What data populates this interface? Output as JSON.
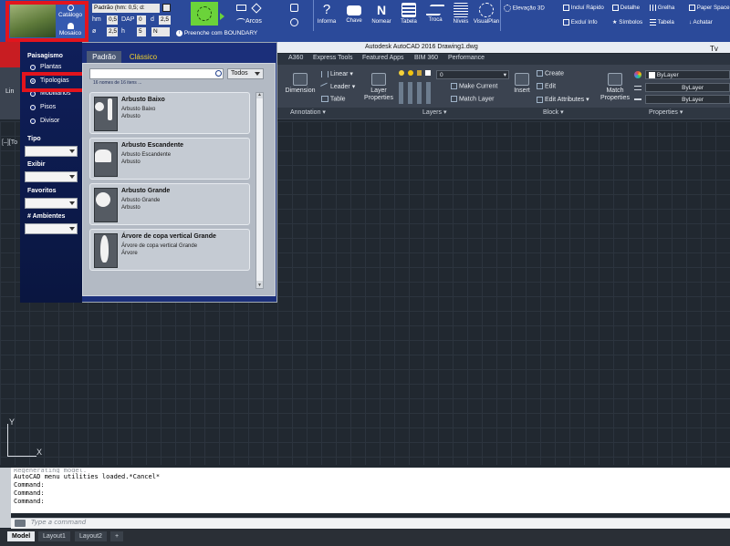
{
  "plugin_ribbon": {
    "catalogo_label": "Catálogo",
    "mosaico_label": "Mosaico",
    "pattern_select": "Padrão (hm: 0,5; d:",
    "hm_label": "hm",
    "hm_value": "0,5",
    "dap_label": "DAP",
    "dap_value": "0",
    "d_label": "d",
    "d_value": "2,5",
    "o_label": "ø",
    "o_value": "2,5",
    "h_label": "h",
    "h_value": "5",
    "n_value": "N",
    "preenche_label": "Preenche com BOUNDARY",
    "arcos_label": "Arcos",
    "buttons": [
      "Informa",
      "Chave",
      "Nomear",
      "Tabela",
      "Troca",
      "Níveis",
      "VisualPlan"
    ],
    "right_items": [
      "Elevação 3D",
      "Incluí Rápido",
      "Detalhe",
      "Grelha",
      "Paper Space",
      "Excluí Info",
      "Símbolos",
      "Tabela",
      "Achatar"
    ]
  },
  "window": {
    "title": "Autodesk AutoCAD 2016    Drawing1.dwg"
  },
  "ribbon_tabs": [
    "A360",
    "Express Tools",
    "Featured Apps",
    "BIM 360",
    "Performance"
  ],
  "autocad_ribbon": {
    "linear_label": "Linear",
    "leader_label": "Leader",
    "table_label": "Table",
    "dimension_label": "Dimension",
    "layer_properties_label": "Layer Properties",
    "layer_value": "0",
    "make_current_label": "Make Current",
    "match_layer_label": "Match Layer",
    "insert_label": "Insert",
    "create_label": "Create",
    "edit_label": "Edit",
    "edit_attributes_label": "Edit Attributes",
    "match_properties_label": "Match Properties",
    "bylayer_1": "ByLayer",
    "bylayer_2": "ByLayer",
    "bylayer_3": "ByLayer",
    "panel_annotation": "Annotation",
    "panel_layers": "Layers",
    "panel_block": "Block",
    "panel_properties": "Properties",
    "line_label": "Lin",
    "tab_partial": "Tv"
  },
  "plugin_panel": {
    "section_title": "Paisagismo",
    "radios": [
      {
        "label": "Plantas",
        "selected": false
      },
      {
        "label": "Tipologias",
        "selected": true
      },
      {
        "label": "Mobiliários",
        "selected": false
      },
      {
        "label": "Pisos",
        "selected": false
      },
      {
        "label": "Divisor",
        "selected": false
      }
    ],
    "tipo_label": "Tipo",
    "exibir_label": "Exibir",
    "favoritos_label": "Favoritos",
    "ambientes_label": "# Ambientes",
    "tab_padrao": "Padrão",
    "tab_classico": "Clássico",
    "search_placeholder": "",
    "filter_value": "Todos",
    "count_text": "16 nomes de 16 itens ...",
    "cards": [
      {
        "title": "Arbusto Baixo",
        "sub1": "Arbusto Baixo",
        "sub2": "Arbusto"
      },
      {
        "title": "Arbusto Escandente",
        "sub1": "Arbusto Escandente",
        "sub2": "Arbusto"
      },
      {
        "title": "Arbusto Grande",
        "sub1": "Arbusto Grande",
        "sub2": "Arbusto"
      },
      {
        "title": "Árvore de copa vertical Grande",
        "sub1": "Árvore de copa vertical Grande",
        "sub2": "Árvore"
      }
    ]
  },
  "drawing": {
    "view_label": "[–][To",
    "ucs_x": "X",
    "ucs_y": "Y"
  },
  "command": {
    "history": [
      "Regenerating model.",
      "AutoCAD menu utilities loaded.*Cancel*",
      "Command:",
      "Command:",
      "Command:"
    ],
    "prompt_placeholder": "Type a command"
  },
  "layout_tabs": [
    "Model",
    "Layout1",
    "Layout2",
    "+"
  ]
}
